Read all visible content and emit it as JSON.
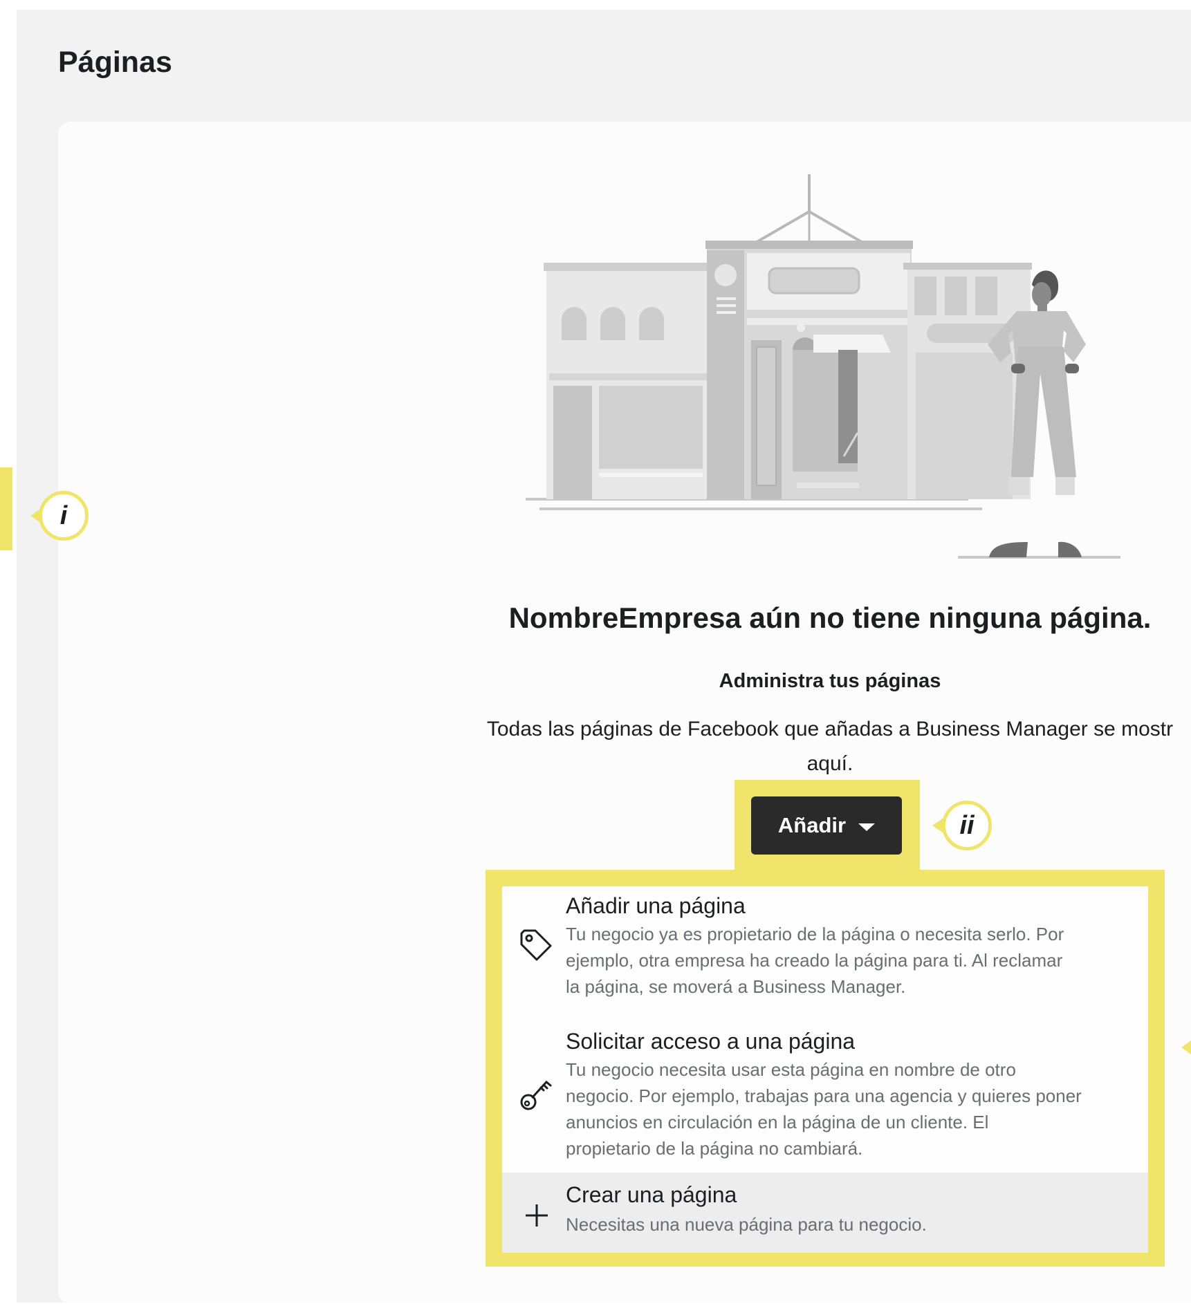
{
  "page": {
    "title": "Páginas"
  },
  "empty_state": {
    "title": "NombreEmpresa aún no tiene ninguna página.",
    "subtitle": "Administra tus páginas",
    "description_lines": [
      "Todas las páginas de Facebook que añadas a Business Manager se mostr",
      "aquí."
    ]
  },
  "add_button": {
    "label": "Añadir",
    "icon": "caret-down-icon"
  },
  "add_menu": {
    "items": [
      {
        "title": "Añadir una página",
        "icon": "tag-icon",
        "description_lines": [
          "Tu negocio ya es propietario de la página o necesita serlo. Por",
          "ejemplo, otra empresa ha creado la página para ti. Al reclamar",
          "la página, se moverá a Business Manager."
        ]
      },
      {
        "title": "Solicitar acceso a una página",
        "icon": "key-icon",
        "description_lines": [
          "Tu negocio necesita usar esta página en nombre de otro",
          "negocio. Por ejemplo, trabajas para una agencia y quieres poner",
          "anuncios en circulación en la página de un cliente. El",
          "propietario de la página no cambiará."
        ]
      },
      {
        "title": "Crear una página",
        "icon": "plus-icon",
        "description_lines": [
          "Necesitas una nueva página para tu negocio."
        ]
      }
    ]
  },
  "annotations": {
    "marker_i": "i",
    "marker_ii": "ii"
  },
  "colors": {
    "highlight": "#f0e46a",
    "button": "#2a2a2a",
    "panel": "#f2f2f2",
    "card": "#fcfcfc",
    "menu_hover": "#ededed"
  }
}
